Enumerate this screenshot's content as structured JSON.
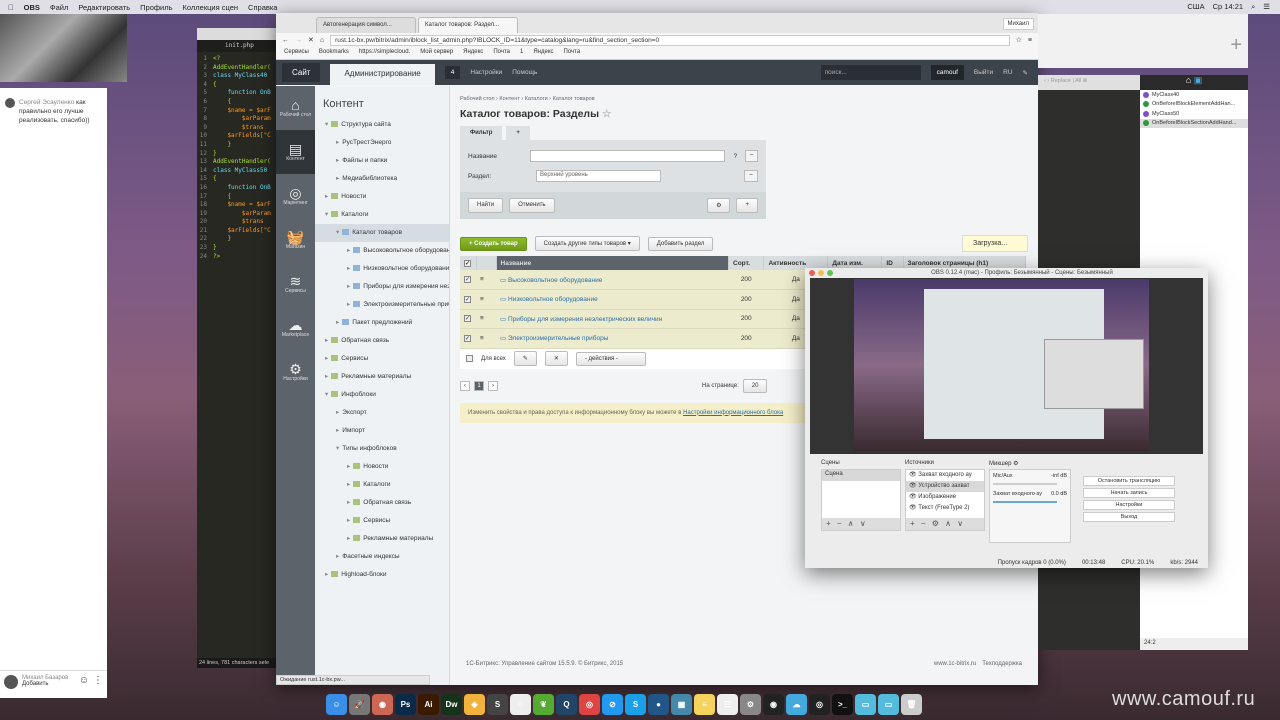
{
  "menubar": {
    "app": "OBS",
    "items": [
      "Файл",
      "Редактировать",
      "Профиль",
      "Коллекция сцен",
      "Справка"
    ],
    "lang": "США",
    "clock": "Ср 14:21"
  },
  "chat": {
    "author": "Сергей Эсауленко",
    "message": "как правильно его лучше реализовать, спасибо))",
    "footer_user": "Михаил Базаров",
    "footer_action": "Добавить"
  },
  "editor": {
    "tab": "init.php",
    "lines": [
      "<?",
      "AddEventHandler(",
      "class MyClass40",
      "{",
      "    function OnB",
      "    {",
      "    $name = $arF",
      "        $arParam",
      "        $trans",
      "    $arFields[\"C",
      "    }",
      "}",
      "AddEventHandler(",
      "class MyClass50",
      "{",
      "    function OnB",
      "    {",
      "    $name = $arF",
      "        $arParam",
      "        $trans",
      "    $arFields[\"C",
      "    }",
      "}",
      "?>"
    ],
    "status": "24 lines, 781 characters sele"
  },
  "browser": {
    "tabs": [
      "Автогенерация символ...",
      "Каталог товаров: Раздел..."
    ],
    "profile": "Михаил",
    "url": "rust.1c-bx.pw/bitrix/admin/iblock_list_admin.php?IBLOCK_ID=11&type=catalog&lang=ru&find_section_section=0",
    "bookmarks": [
      "Сервисы",
      "Bookmarks",
      "https://simplecloud.",
      "Мой сервер",
      "Яндекс",
      "Почта",
      "1",
      "Яндекс",
      "Почта"
    ],
    "status": "Ожидание rust.1c-bx.pw..."
  },
  "admin": {
    "site": "Сайт",
    "admin": "Администрирование",
    "notif_count": "4",
    "settings": "Настройки",
    "help": "Помощь",
    "search_placeholder": "поиск...",
    "user": "camouf",
    "logout": "Выйти",
    "lang": "RU"
  },
  "iconbar": [
    {
      "label": "Рабочий стол",
      "icon": "home-icon"
    },
    {
      "label": "Контент",
      "icon": "content-icon"
    },
    {
      "label": "Маркетинг",
      "icon": "target-icon"
    },
    {
      "label": "Магазин",
      "icon": "basket-icon"
    },
    {
      "label": "Сервисы",
      "icon": "layers-icon"
    },
    {
      "label": "Marketplace",
      "icon": "cloud-icon"
    },
    {
      "label": "Настройки",
      "icon": "gear-icon"
    }
  ],
  "tree": {
    "title": "Контент",
    "items": [
      {
        "l": "Структура сайта",
        "d": 0,
        "a": "▾",
        "f": "g"
      },
      {
        "l": "РусТрестЭнерго",
        "d": 1,
        "a": "▸"
      },
      {
        "l": "Файлы и папки",
        "d": 1,
        "a": "▸"
      },
      {
        "l": "Медиабиблиотека",
        "d": 1,
        "a": "▸"
      },
      {
        "l": "Новости",
        "d": 0,
        "a": "▸",
        "f": "g"
      },
      {
        "l": "Каталоги",
        "d": 0,
        "a": "▾",
        "f": "g"
      },
      {
        "l": "Каталог товаров",
        "d": 1,
        "a": "▾",
        "f": "b",
        "sel": true
      },
      {
        "l": "Высоковольтное оборудование",
        "d": 2,
        "a": "▸",
        "f": "b"
      },
      {
        "l": "Низковольтное оборудование",
        "d": 2,
        "a": "▸",
        "f": "b"
      },
      {
        "l": "Приборы для измерения неэлектрических величин",
        "d": 2,
        "a": "▸",
        "f": "b"
      },
      {
        "l": "Электроизмерительные приборы",
        "d": 2,
        "a": "▸",
        "f": "b"
      },
      {
        "l": "Пакет предложений",
        "d": 1,
        "a": "▸",
        "f": "b"
      },
      {
        "l": "Обратная связь",
        "d": 0,
        "a": "▸",
        "f": "g"
      },
      {
        "l": "Сервисы",
        "d": 0,
        "a": "▸",
        "f": "g"
      },
      {
        "l": "Рекламные материалы",
        "d": 0,
        "a": "▸",
        "f": "g"
      },
      {
        "l": "Инфоблоки",
        "d": 0,
        "a": "▾",
        "f": "g"
      },
      {
        "l": "Экспорт",
        "d": 1,
        "a": "▸"
      },
      {
        "l": "Импорт",
        "d": 1,
        "a": "▸"
      },
      {
        "l": "Типы инфоблоков",
        "d": 1,
        "a": "▾"
      },
      {
        "l": "Новости",
        "d": 2,
        "a": "▸",
        "f": "g"
      },
      {
        "l": "Каталоги",
        "d": 2,
        "a": "▸",
        "f": "g"
      },
      {
        "l": "Обратная связь",
        "d": 2,
        "a": "▸",
        "f": "g"
      },
      {
        "l": "Сервисы",
        "d": 2,
        "a": "▸",
        "f": "g"
      },
      {
        "l": "Рекламные материалы",
        "d": 2,
        "a": "▸",
        "f": "g"
      },
      {
        "l": "Фасетные индексы",
        "d": 1,
        "a": "▸"
      },
      {
        "l": "Highload-блоки",
        "d": 0,
        "a": "▸",
        "f": "g"
      }
    ]
  },
  "main": {
    "breadcrumb": [
      "Рабочий стол",
      "Контент",
      "Каталоги",
      "Каталог товаров"
    ],
    "title": "Каталог товаров: Разделы",
    "filter": {
      "tab": "Фильтр",
      "name_label": "Название",
      "name_value": "",
      "section_label": "Раздел:",
      "section_value": "Верхний уровень",
      "find": "Найти",
      "cancel": "Отменить"
    },
    "toolbar": {
      "create": "Создать товар",
      "create_other": "Создать другие типы товаров",
      "add_section": "Добавить раздел",
      "loading": "Загрузка..."
    },
    "columns": [
      "Название",
      "Сорт.",
      "Активность",
      "Дата изм.",
      "ID",
      "Заголовок страницы (h1)"
    ],
    "rows": [
      {
        "name": "Высоковольтное оборудование",
        "sort": "200",
        "active": "Да"
      },
      {
        "name": "Низковольтное оборудование",
        "sort": "200",
        "active": "Да"
      },
      {
        "name": "Приборы для измерения неэлектрических величин",
        "sort": "200",
        "active": "Да"
      },
      {
        "name": "Электроизмерительные приборы",
        "sort": "200",
        "active": "Да"
      }
    ],
    "for_all": "Для всех",
    "actions": "- действия -",
    "page": "1",
    "per_page_label": "На странице:",
    "per_page": "20",
    "note": "Изменить свойства и права доступа к информационному блоку вы можете в",
    "note_link": "Настройки информационного блока",
    "footer": "1С-Битрикс: Управление сайтом 15.5.9. © Битрикс, 2015",
    "footer_site": "www.1c-bitrix.ru",
    "support": "Техподдержка"
  },
  "right": {
    "replace": "Replace",
    "all": "All",
    "symbols": [
      {
        "name": "MyClass40",
        "c": "#7b4fc9"
      },
      {
        "name": "OnBeforeIBlockElementAddHan...",
        "c": "#2a9a3a"
      },
      {
        "name": "MyClass50",
        "c": "#7b4fc9"
      },
      {
        "name": "OnBeforeIBlockSectionAddHand...",
        "c": "#2a9a3a"
      }
    ],
    "line_info": "24:2"
  },
  "obs": {
    "title": "OBS 0.12.4 (mac) - Профиль: Безымянный - Сцены: Безымянный",
    "scenes_label": "Сцены",
    "scenes": [
      "Сцена"
    ],
    "sources_label": "Источники",
    "sources": [
      "Захват входного ау",
      "Устройство захват",
      "Изображение",
      "Текст (FreeType 2)"
    ],
    "mixer_label": "Микшер",
    "mixer": [
      {
        "name": "Mic/Aux",
        "db": "-inf dB",
        "level": 0
      },
      {
        "name": "Захват входного ау",
        "db": "0.0 dB",
        "level": 1
      }
    ],
    "buttons": [
      "Остановить трансляцию",
      "Начать запись",
      "Настройки",
      "Выход"
    ],
    "dropped": "Пропуск кадров 0 (0.0%)",
    "time": "00:13:48",
    "cpu": "CPU: 20.1%",
    "kbs": "kb/s: 2944"
  },
  "dock": [
    {
      "n": "finder",
      "c": "#3a8ee6",
      "g": "☺"
    },
    {
      "n": "launchpad",
      "c": "#777",
      "g": "🚀"
    },
    {
      "n": "firefox",
      "c": "#c65",
      "g": "◉"
    },
    {
      "n": "photoshop",
      "c": "#0b2a4a",
      "g": "Ps"
    },
    {
      "n": "illustrator",
      "c": "#3a1a00",
      "g": "Ai"
    },
    {
      "n": "dreamweaver",
      "c": "#14331a",
      "g": "Dw"
    },
    {
      "n": "sketch",
      "c": "#f2b33d",
      "g": "◆"
    },
    {
      "n": "sublime",
      "c": "#444",
      "g": "S"
    },
    {
      "n": "adium",
      "c": "#eee",
      "g": "☺"
    },
    {
      "n": "evernote",
      "c": "#5a3",
      "g": "❦"
    },
    {
      "n": "quicktime",
      "c": "#246",
      "g": "Q"
    },
    {
      "n": "chrome",
      "c": "#d44",
      "g": "◎"
    },
    {
      "n": "safari",
      "c": "#29e",
      "g": "⊘"
    },
    {
      "n": "skype",
      "c": "#1aa0e8",
      "g": "S"
    },
    {
      "n": "messenger",
      "c": "#258",
      "g": "●"
    },
    {
      "n": "preview",
      "c": "#48a",
      "g": "▦"
    },
    {
      "n": "notes",
      "c": "#f4d35e",
      "g": "≡"
    },
    {
      "n": "reminders",
      "c": "#eee",
      "g": "☰"
    },
    {
      "n": "system-prefs",
      "c": "#888",
      "g": "⚙"
    },
    {
      "n": "speaker-app",
      "c": "#222",
      "g": "◉"
    },
    {
      "n": "cloud-app",
      "c": "#4ad",
      "g": "☁"
    },
    {
      "n": "obs",
      "c": "#222",
      "g": "◎"
    },
    {
      "n": "terminal",
      "c": "#111",
      "g": ">_"
    },
    {
      "n": "folder-apps",
      "c": "#5bd",
      "g": "▭"
    },
    {
      "n": "folder-downloads",
      "c": "#5bd",
      "g": "▭"
    },
    {
      "n": "trash",
      "c": "#ccc",
      "g": "🗑"
    }
  ],
  "watermark": "www.camouf.ru"
}
